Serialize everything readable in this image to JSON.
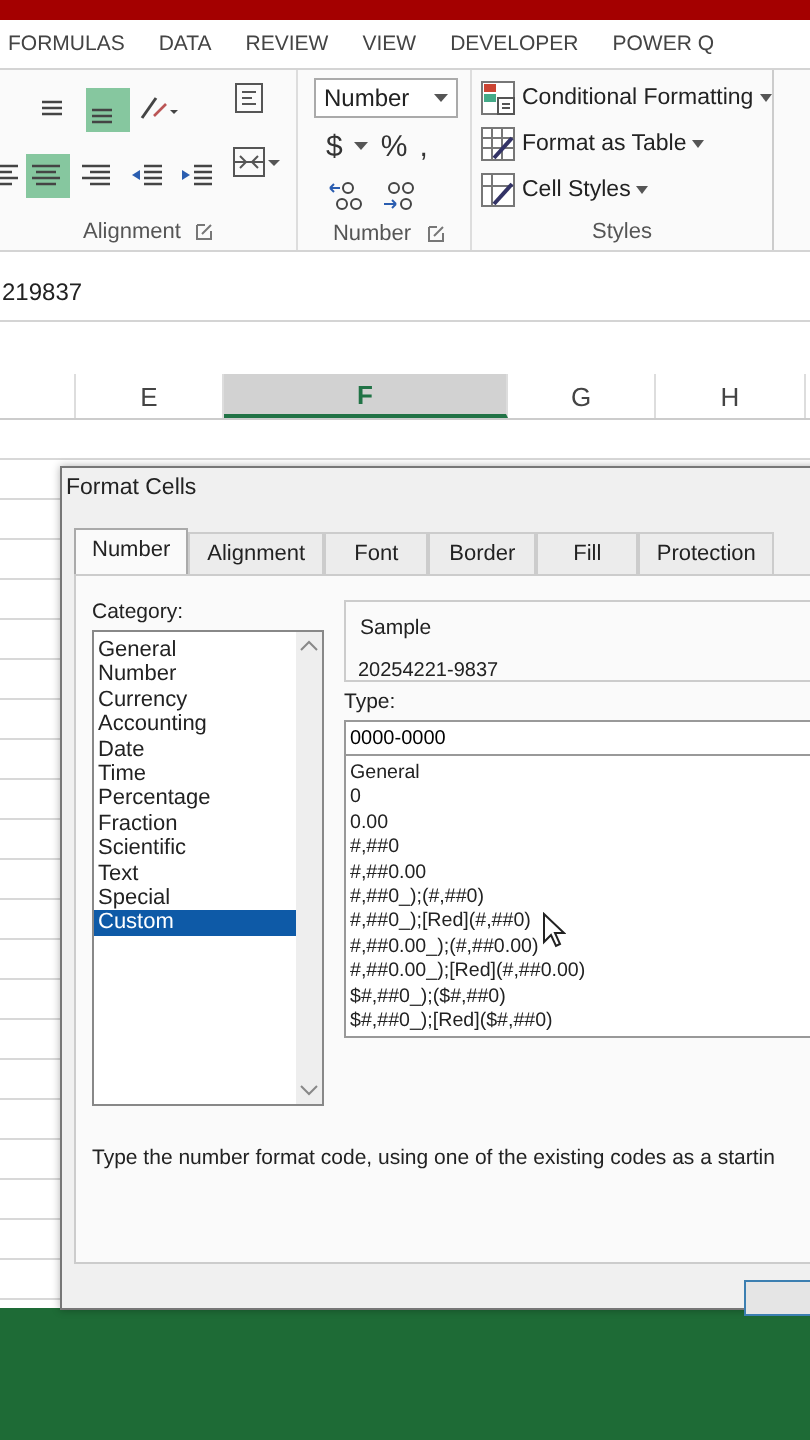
{
  "ribbon_tabs": [
    {
      "label": "FORMULAS",
      "selected": false
    },
    {
      "label": "DATA",
      "selected": false
    },
    {
      "label": "REVIEW",
      "selected": false
    },
    {
      "label": "VIEW",
      "selected": false
    },
    {
      "label": "DEVELOPER",
      "selected": false
    },
    {
      "label": "POWER Q",
      "selected": false
    }
  ],
  "alignment_group": {
    "label": "Alignment",
    "top_row": [
      {
        "kind": "align-middle",
        "selected": false
      },
      {
        "kind": "align-bottom",
        "selected": true
      },
      {
        "kind": "orientation",
        "selected": false
      }
    ],
    "bottom_row": [
      {
        "kind": "align-center",
        "selected": true
      },
      {
        "kind": "align-right",
        "selected": false
      },
      {
        "kind": "indent-less",
        "selected": false
      },
      {
        "kind": "indent-more",
        "selected": false
      }
    ]
  },
  "number_group": {
    "label": "Number",
    "format": "Number",
    "symbols": [
      "$",
      "%",
      ","
    ]
  },
  "styles_group": {
    "label": "Styles",
    "items": [
      {
        "kind": "conditional",
        "label": "Conditional Formatting"
      },
      {
        "kind": "table",
        "label": "Format as Table"
      },
      {
        "kind": "cell",
        "label": "Cell Styles"
      }
    ]
  },
  "formula_bar": {
    "value": "219837"
  },
  "columns": [
    {
      "selected": false
    },
    {
      "label": "E",
      "selected": false
    },
    {
      "label": "F",
      "selected": true
    },
    {
      "label": "G",
      "selected": false
    },
    {
      "label": "H",
      "selected": false
    }
  ],
  "dialog": {
    "title": "Format Cells",
    "tabs": [
      {
        "label": "Number",
        "selected": true
      },
      {
        "label": "Alignment",
        "selected": false
      },
      {
        "label": "Font",
        "selected": false
      },
      {
        "label": "Border",
        "selected": false
      },
      {
        "label": "Fill",
        "selected": false
      },
      {
        "label": "Protection",
        "selected": false
      }
    ],
    "category_label": "Category:",
    "categories": [
      {
        "label": "General",
        "selected": false
      },
      {
        "label": "Number",
        "selected": false
      },
      {
        "label": "Currency",
        "selected": false
      },
      {
        "label": "Accounting",
        "selected": false
      },
      {
        "label": "Date",
        "selected": false
      },
      {
        "label": "Time",
        "selected": false
      },
      {
        "label": "Percentage",
        "selected": false
      },
      {
        "label": "Fraction",
        "selected": false
      },
      {
        "label": "Scientific",
        "selected": false
      },
      {
        "label": "Text",
        "selected": false
      },
      {
        "label": "Special",
        "selected": false
      },
      {
        "label": "Custom",
        "selected": true
      }
    ],
    "sample_label": "Sample",
    "sample_value": "20254221-9837",
    "type_label": "Type:",
    "type_value": "0000-0000",
    "type_codes": [
      "General",
      "0",
      "0.00",
      "#,##0",
      "#,##0.00",
      "#,##0_);(#,##0)",
      "#,##0_);[Red](#,##0)",
      "#,##0.00_);(#,##0.00)",
      "#,##0.00_);[Red](#,##0.00)",
      "$#,##0_);($#,##0)",
      "$#,##0_);[Red]($#,##0)"
    ],
    "description": "Type the number format code, using one of the existing codes as a startin"
  }
}
